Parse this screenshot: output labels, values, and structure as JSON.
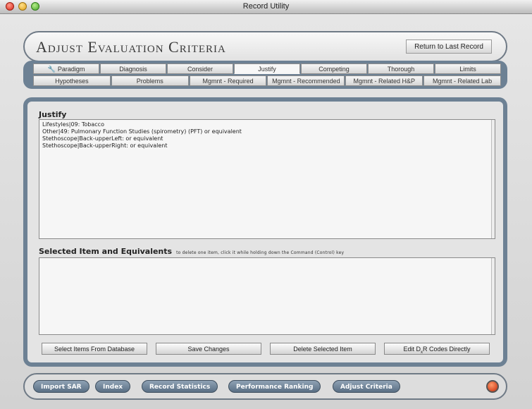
{
  "window": {
    "title": "Record Utility"
  },
  "header": {
    "title": "Adjust Evaluation Criteria",
    "return_label": "Return to Last Record"
  },
  "tabs_row1": [
    {
      "label": "Paradigm",
      "icon": "wrench-icon",
      "active": false
    },
    {
      "label": "Diagnosis"
    },
    {
      "label": "Consider"
    },
    {
      "label": "Justify",
      "active": true
    },
    {
      "label": "Competing"
    },
    {
      "label": "Thorough"
    },
    {
      "label": "Limits"
    }
  ],
  "tabs_row2": [
    {
      "label": "Hypotheses"
    },
    {
      "label": "Problems"
    },
    {
      "label": "Mgmnt - Required"
    },
    {
      "label": "Mgmnt - Recommended"
    },
    {
      "label": "Mgmnt - Related H&P"
    },
    {
      "label": "Mgmnt - Related Lab"
    }
  ],
  "justify": {
    "label": "Justify",
    "items": [
      "Lifestyles|09: Tobacco",
      "Other|49: Pulmonary Function Studies (spirometry) (PFT) or equivalent",
      "Stethoscope|Back-upperLeft: or equivalent",
      "Stethoscope|Back-upperRight: or equivalent"
    ]
  },
  "selected": {
    "label": "Selected Item and Equivalents",
    "hint": "to delete one item, click it while holding down the Command (Control) key"
  },
  "actions": {
    "select_items": "Select Items From Database",
    "save_changes": "Save Changes",
    "delete_selected": "Delete Selected Item",
    "edit_codes_pre": "Edit D",
    "edit_codes_sub": "x",
    "edit_codes_post": "R Codes Directly"
  },
  "nav": {
    "import": "Import SAR",
    "index": "Index",
    "record_stats": "Record Statistics",
    "performance": "Performance Ranking",
    "adjust": "Adjust Criteria"
  },
  "colors": {
    "panel": "#6d8194",
    "nav_button": "#6f8399",
    "power": "#d0381a"
  }
}
